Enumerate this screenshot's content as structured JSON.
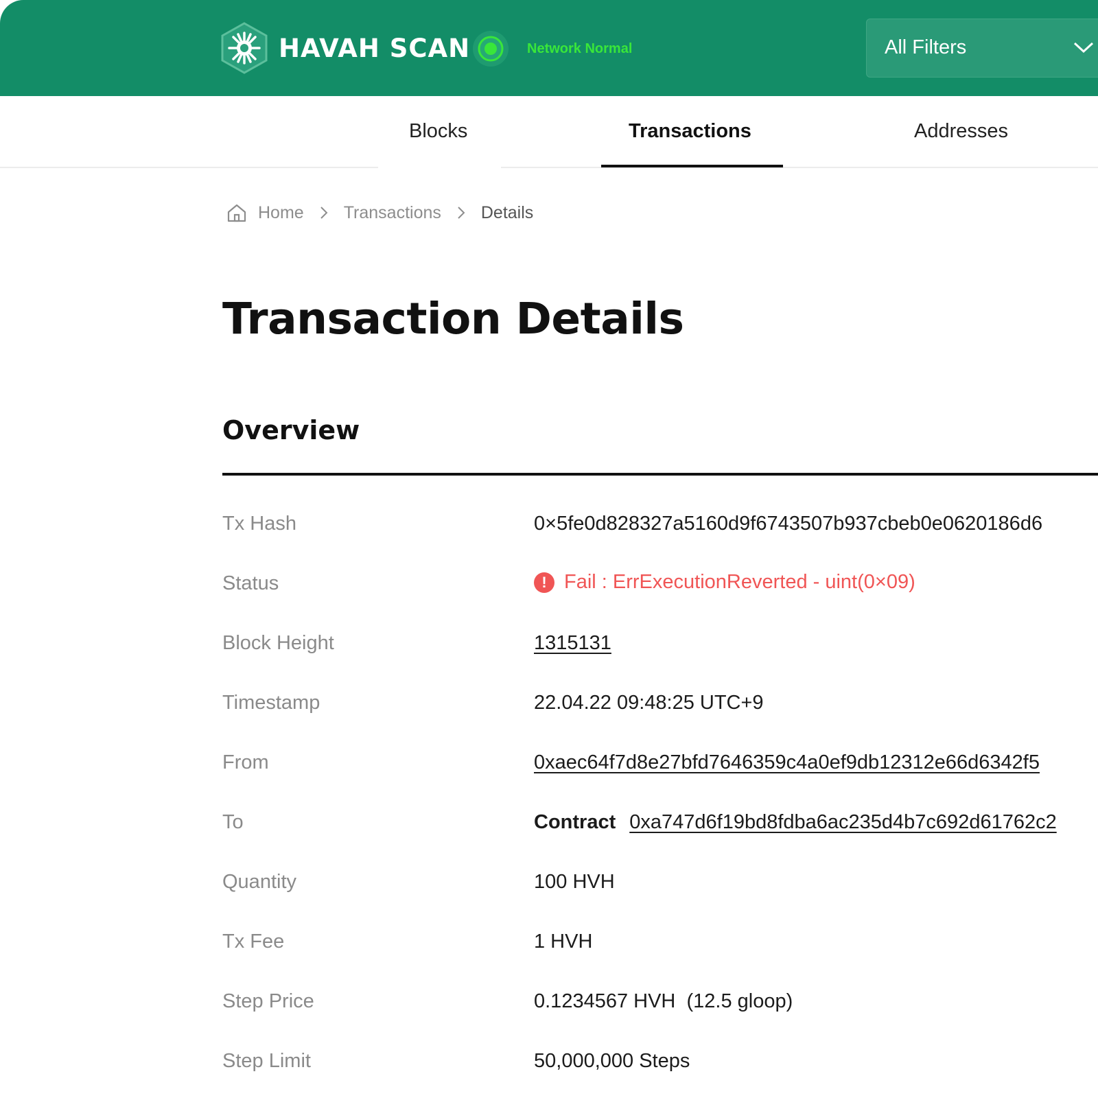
{
  "header": {
    "brand": "HAVAH SCAN",
    "network_status": "Network Normal",
    "filter_label": "All Filters"
  },
  "nav": {
    "tabs": [
      {
        "label": "Blocks"
      },
      {
        "label": "Transactions"
      },
      {
        "label": "Addresses"
      }
    ],
    "active_tab": "Transactions"
  },
  "breadcrumb": {
    "home": "Home",
    "section": "Transactions",
    "current": "Details"
  },
  "page_title": "Transaction Details",
  "overview": {
    "title": "Overview",
    "rows": {
      "tx_hash": {
        "label": "Tx Hash",
        "value": "0×5fe0d828327a5160d9f6743507b937cbeb0e0620186d6"
      },
      "status": {
        "label": "Status",
        "value": "Fail : ErrExecutionReverted - uint(0×09)"
      },
      "block_height": {
        "label": "Block Height",
        "value": "1315131"
      },
      "timestamp": {
        "label": "Timestamp",
        "value": "22.04.22 09:48:25 UTC+9"
      },
      "from": {
        "label": "From",
        "value": "0xaec64f7d8e27bfd7646359c4a0ef9db12312e66d6342f5"
      },
      "to": {
        "label": "To",
        "tag": "Contract",
        "value": "0xa747d6f19bd8fdba6ac235d4b7c692d61762c2"
      },
      "quantity": {
        "label": "Quantity",
        "value": "100 HVH"
      },
      "tx_fee": {
        "label": "Tx Fee",
        "value": "1 HVH"
      },
      "step_price": {
        "label": "Step Price",
        "value": "0.1234567 HVH  (12.5 gloop)"
      },
      "step_limit": {
        "label": "Step Limit",
        "value": "50,000,000 Steps"
      }
    }
  },
  "colors": {
    "brand_green": "#138d67",
    "status_ok": "#39e63a",
    "fail_red": "#f05555"
  },
  "icons": [
    "havah-logo-icon",
    "network-status-dot-icon",
    "chevron-down-icon",
    "home-icon",
    "chevron-right-icon",
    "error-icon"
  ]
}
